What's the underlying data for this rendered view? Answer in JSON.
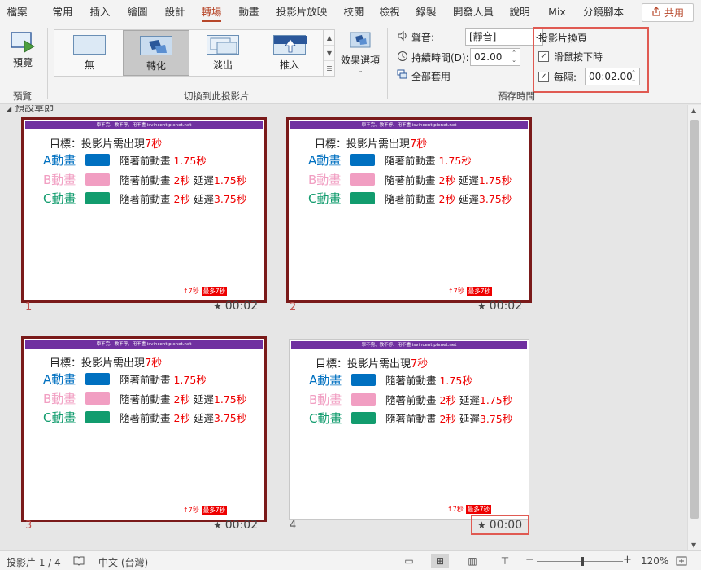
{
  "tabs": [
    "檔案",
    "常用",
    "插入",
    "繪圖",
    "設計",
    "轉場",
    "動畫",
    "投影片放映",
    "校閱",
    "檢視",
    "錄製",
    "開發人員",
    "說明",
    "Mix",
    "分鏡腳本"
  ],
  "active_tab": "轉場",
  "share_label": "共用",
  "ribbon": {
    "preview_label": "預覽",
    "preview_group": "預覽",
    "transitions": [
      "無",
      "轉化",
      "淡出",
      "推入"
    ],
    "selected_transition": "轉化",
    "transitions_group": "切換到此投影片",
    "effect_options_label": "效果選項",
    "sound_label": "聲音:",
    "sound_value": "[靜音]",
    "duration_label": "持續時間(D):",
    "duration_value": "02.00",
    "apply_all_label": "全部套用",
    "advance_title": "投影片換頁",
    "on_click_label": "滑鼠按下時",
    "after_label": "每隔:",
    "after_value": "00:02.00",
    "timing_group": "預存時間"
  },
  "section_title": "預設章節",
  "slide_content": {
    "banner": "學不完、教不停、用不盡 isvincent.pixnet.net",
    "goal_prefix": "目標：投影片需出現",
    "goal_value": "7秒",
    "rows": [
      {
        "name": "A動畫",
        "color": "#0070c0",
        "name_color": "#0070c0",
        "desc_prefix": "隨著前動畫 ",
        "desc_value": "1.75秒",
        "desc_mid": "",
        "desc_value2": ""
      },
      {
        "name": "B動畫",
        "color": "#f19ec2",
        "name_color": "#f19ec2",
        "desc_prefix": "隨著前動畫 ",
        "desc_value": "2秒",
        "desc_mid": " 延遲",
        "desc_value2": "1.75秒"
      },
      {
        "name": "C動畫",
        "color": "#129c6e",
        "name_color": "#129c6e",
        "desc_prefix": "隨著前動畫 ",
        "desc_value": "2秒",
        "desc_mid": " 延遲",
        "desc_value2": "3.75秒"
      }
    ],
    "foot_arrow": "↑7秒",
    "foot_badge": "最多7秒"
  },
  "slides": [
    {
      "number": "1",
      "time": "00:02",
      "selected": true
    },
    {
      "number": "2",
      "time": "00:02",
      "selected": true
    },
    {
      "number": "3",
      "time": "00:02",
      "selected": true
    },
    {
      "number": "4",
      "time": "00:00",
      "selected": false
    }
  ],
  "status": {
    "slide_info": "投影片 1 / 4",
    "language": "中文 (台灣)",
    "zoom": "120%"
  }
}
